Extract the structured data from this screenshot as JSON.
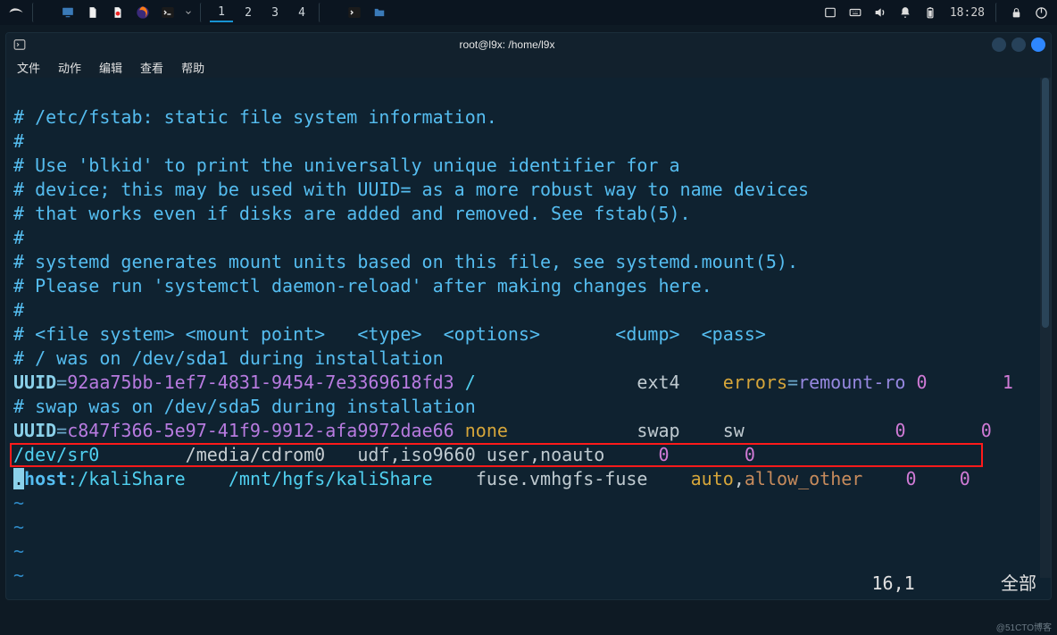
{
  "taskbar": {
    "workspaces": [
      "1",
      "2",
      "3",
      "4"
    ],
    "active_workspace": 0,
    "clock": "18:28"
  },
  "window": {
    "title": "root@l9x: /home/l9x"
  },
  "menubar": {
    "items": [
      "文件",
      "动作",
      "编辑",
      "查看",
      "帮助"
    ]
  },
  "fstab": {
    "comments": [
      "# /etc/fstab: static file system information.",
      "#",
      "# Use 'blkid' to print the universally unique identifier for a",
      "# device; this may be used with UUID= as a more robust way to name devices",
      "# that works even if disks are added and removed. See fstab(5).",
      "#",
      "# systemd generates mount units based on this file, see systemd.mount(5).",
      "# Please run 'systemctl daemon-reload' after making changes here.",
      "#",
      "# <file system> <mount point>   <type>  <options>       <dump>  <pass>",
      "# / was on /dev/sda1 during installation"
    ],
    "entry_root": {
      "key": "UUID",
      "uuid": "92aa75bb-1ef7-4831-9454-7e3369618fd3",
      "mount": "/",
      "type": "ext4",
      "opts_k": "errors",
      "opts_v": "remount-ro",
      "dump": "0",
      "pass": "1"
    },
    "swap_comment": "# swap was on /dev/sda5 during installation",
    "entry_swap": {
      "key": "UUID",
      "uuid": "c847f366-5e97-41f9-9912-afa9972dae66",
      "mount": "none",
      "type": "swap",
      "opts": "sw",
      "dump": "0",
      "pass": "0"
    },
    "entry_cdrom": {
      "dev": "/dev/sr0",
      "mount": "/media/cdrom0",
      "type": "udf,iso9660",
      "opts": "user,noauto",
      "dump": "0",
      "pass": "0"
    },
    "entry_hgfs": {
      "dot": ".",
      "host": "host",
      "colon": ":",
      "share": "/kaliShare",
      "mount": "/mnt/hgfs/kaliShare",
      "type": "fuse.vmhgfs-fuse",
      "opt_a": "auto",
      "opt_b": "allow_other",
      "dump": "0",
      "pass": "0"
    }
  },
  "vim_status": {
    "pos": "16,1",
    "mode": "全部"
  },
  "watermark": "@51CTO博客"
}
